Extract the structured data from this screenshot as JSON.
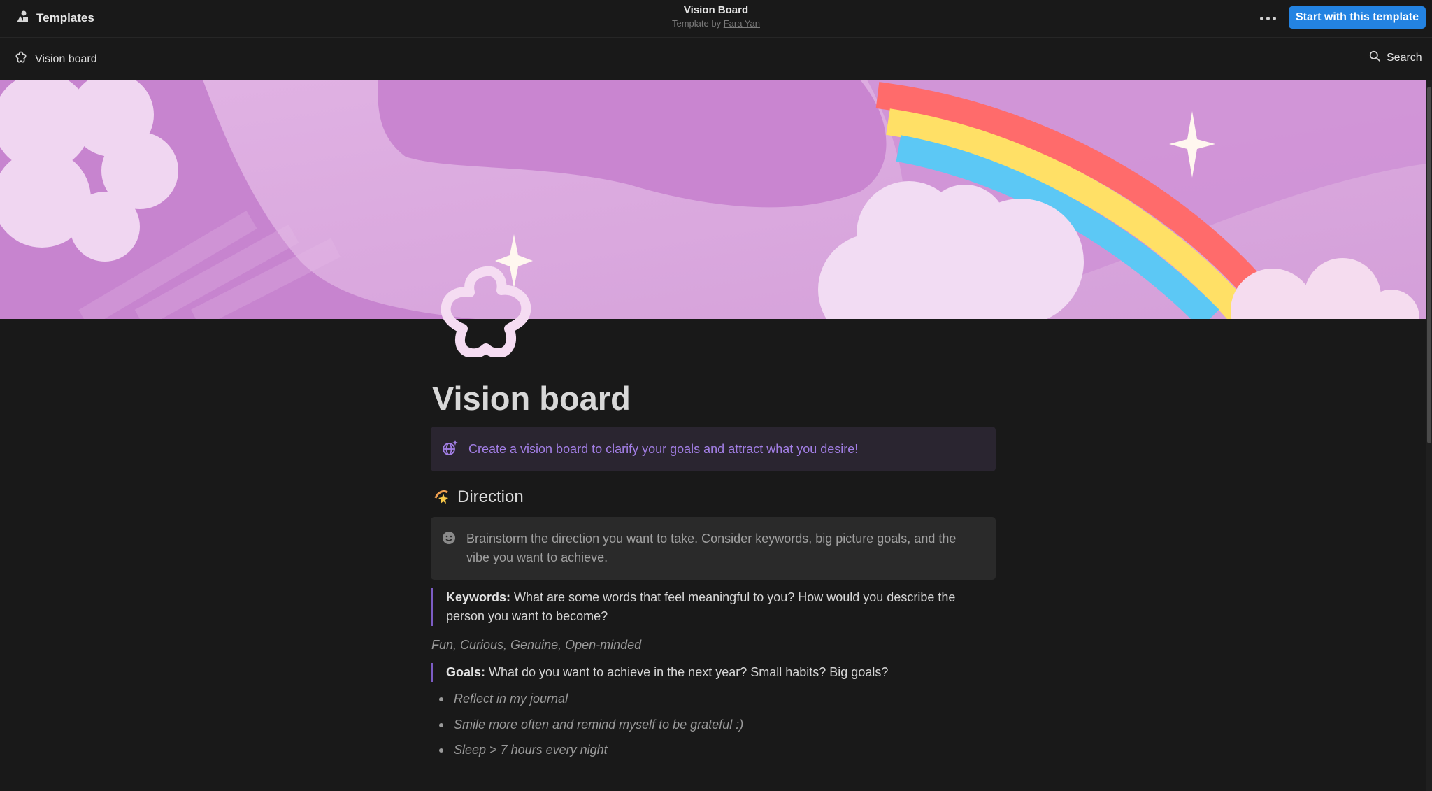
{
  "topbar": {
    "templates_label": "Templates",
    "title": "Vision Board",
    "byline_prefix": "Template by ",
    "author": "Fara Yan",
    "cta_label": "Start with this template"
  },
  "breadcrumb": {
    "page": "Vision board"
  },
  "search": {
    "label": "Search"
  },
  "page": {
    "title": "Vision board",
    "intro_callout": "Create a vision board to clarify your goals and attract what you desire!",
    "section_heading": "Direction",
    "direction_callout": "Brainstorm the direction you want to take. Consider keywords, big picture goals, and the vibe you want to achieve.",
    "keywords": {
      "label": "Keywords:",
      "question": " What are some words that feel meaningful to you? How would you describe the person you want to become?",
      "answer": "Fun, Curious, Genuine, Open-minded"
    },
    "goals": {
      "label": "Goals:",
      "question": " What do you want to achieve in the next year? Small habits? Big goals?",
      "items": [
        "Reflect in my journal",
        "Smile more often and remind myself to be grateful :)",
        "Sleep > 7 hours every night"
      ]
    }
  },
  "colors": {
    "accent_button": "#2383e2",
    "callout_purple_text": "#a37fe6",
    "quote_bar": "#7c5cc4",
    "cover_pink": "#d9a3df"
  },
  "icons": [
    "templates-icon",
    "more-options-icon",
    "flower-page-icon",
    "search-icon",
    "sparkle-globe-icon",
    "shooting-star-icon",
    "smiley-icon"
  ]
}
